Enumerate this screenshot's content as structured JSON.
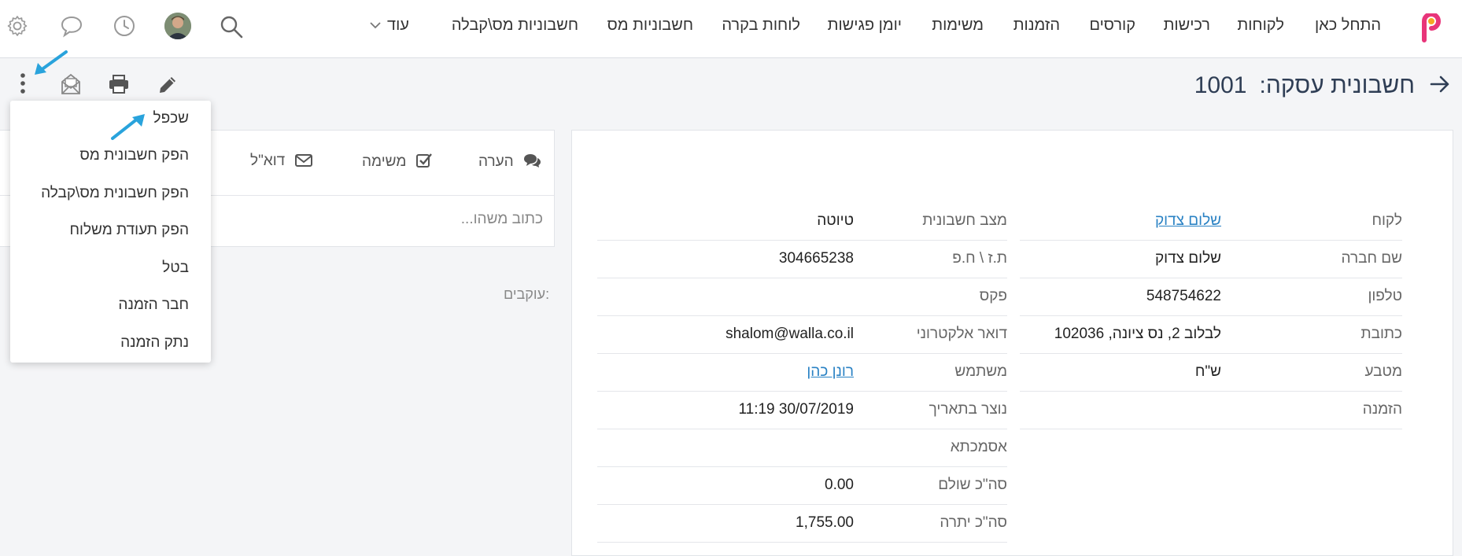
{
  "nav": {
    "items": [
      "התחל כאן",
      "לקוחות",
      "רכישות",
      "קורסים",
      "הזמנות",
      "משימות",
      "יומן פגישות",
      "לוחות בקרה",
      "חשבוניות מס",
      "חשבוניות מס\\קבלה"
    ],
    "more_label": "עוד"
  },
  "header": {
    "title": "חשבונית עסקה:",
    "number": "1001"
  },
  "details": {
    "left_column": [
      {
        "label": "לקוח",
        "value": "שלום צדוק",
        "link": true
      },
      {
        "label": "שם חברה",
        "value": "שלום צדוק"
      },
      {
        "label": "טלפון",
        "value": "548754622"
      },
      {
        "label": "כתובת",
        "value": "לבלוב 2, נס ציונה, 102036"
      },
      {
        "label": "מטבע",
        "value": "ש\"ח"
      },
      {
        "label": "הזמנה",
        "value": ""
      }
    ],
    "right_column": [
      {
        "label": "מצב חשבונית",
        "value": "טיוטה"
      },
      {
        "label": "ת.ז \\ ח.פ",
        "value": "304665238"
      },
      {
        "label": "פקס",
        "value": ""
      },
      {
        "label": "דואר אלקטרוני",
        "value": "shalom@walla.co.il"
      },
      {
        "label": "משתמש",
        "value": "רונן כהן",
        "link": true
      },
      {
        "label": "נוצר בתאריך",
        "value": "11:19 30/07/2019"
      },
      {
        "label": "אסמכתא",
        "value": ""
      },
      {
        "label": "סה\"כ שולם",
        "value": "0.00"
      },
      {
        "label": "סה\"כ יתרה",
        "value": "1,755.00"
      }
    ]
  },
  "activity": {
    "tabs": {
      "note": "הערה",
      "task": "משימה",
      "email": "דוא\"ל"
    },
    "input_placeholder": "כתוב משהו...",
    "followers_label": "עוקבים:"
  },
  "menu": {
    "items": [
      "שכפל",
      "הפק חשבונית מס",
      "הפק חשבונית מס\\קבלה",
      "הפק תעודת משלוח",
      "בטל",
      "חבר הזמנה",
      "נתק הזמנה"
    ]
  },
  "colors": {
    "accent": "#2a82c4",
    "annotation_arrow": "#29a3dc",
    "logo_pink": "#e8357a",
    "logo_orange": "#f5a623"
  }
}
